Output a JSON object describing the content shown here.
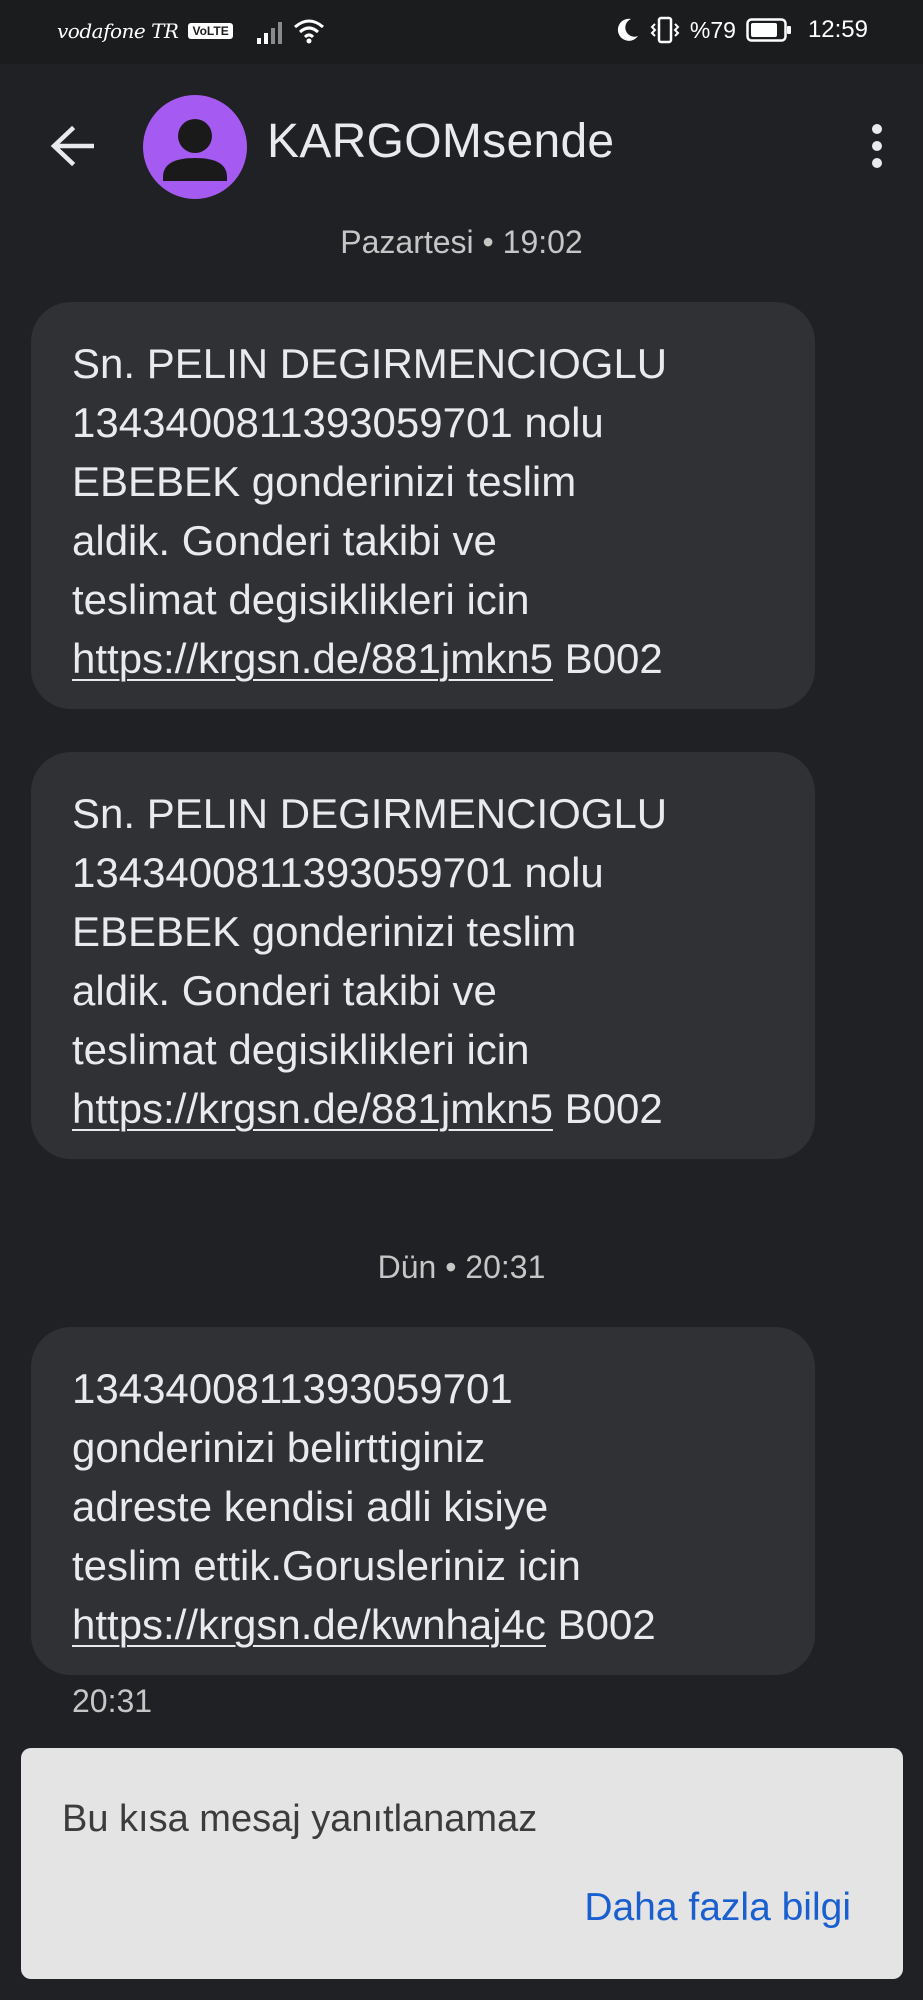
{
  "status_bar": {
    "carrier": "vodafone TR",
    "volte": "VoLTE",
    "battery_percent": "%79",
    "time": "12:59",
    "icons": [
      "signal-icon",
      "wifi-icon",
      "moon-icon",
      "vibrate-icon",
      "battery-icon"
    ]
  },
  "header": {
    "contact_name": "KARGOMsende",
    "avatar_color": "#a55bf2",
    "back_icon": "arrow-left-icon",
    "more_icon": "more-vert-icon"
  },
  "messages": [
    {
      "separator": "Pazartesi • 19:02",
      "text_before": "Sn. PELIN DEGIRMENCIOGLU\n134340081139305970​1 nolu\nEBEBEK gonderinizi teslim\naldik. Gonderi takibi ve\nteslimat degisiklikleri icin\n",
      "link": "https://krgsn.de/881jmkn5",
      "text_after": " B002"
    },
    {
      "text_before": "Sn. PELIN DEGIRMENCIOGLU\n134340081139305970​1 nolu\nEBEBEK gonderinizi teslim\naldik. Gonderi takibi ve\nteslimat degisiklikleri icin\n",
      "link": "https://krgsn.de/881jmkn5",
      "text_after": " B002"
    },
    {
      "separator": "Dün • 20:31",
      "text_before": "134340081139305970​1\ngonderinizi belirttiginiz\nadreste kendisi  adli kisiye\nteslim ettik.Gorusleriniz icin\n",
      "link": "https://krgsn.de/kwnhaj4c",
      "text_after": " B002",
      "timestamp": "20:31"
    }
  ],
  "footer": {
    "no_reply_text": "Bu kısa mesaj yanıtlanamaz",
    "more_info_label": "Daha fazla bilgi"
  }
}
